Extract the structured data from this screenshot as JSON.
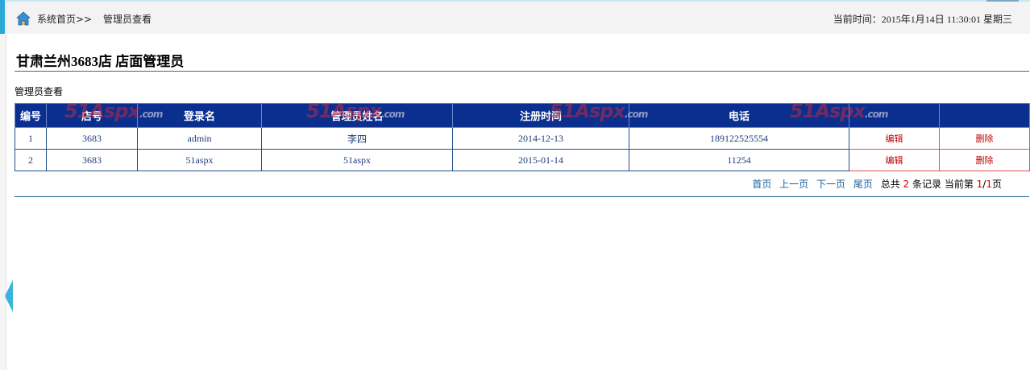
{
  "breadcrumb": {
    "home": "系统首页>>",
    "current": "管理员查看"
  },
  "clock": {
    "label": "当前时间：",
    "value": "2015年1月14日 11:30:01 星期三"
  },
  "store_title": "甘肃兰州3683店 店面管理员",
  "section_label": "管理员查看",
  "table": {
    "headers": [
      "编号",
      "店号",
      "登录名",
      "管理员姓名",
      "注册时间",
      "电话",
      "",
      ""
    ],
    "rows": [
      {
        "id": "1",
        "store": "3683",
        "login": "admin",
        "name": "李四",
        "registered": "2014-12-13",
        "phone": "189122525554",
        "edit": "编辑",
        "delete": "删除"
      },
      {
        "id": "2",
        "store": "3683",
        "login": "51aspx",
        "name": "51aspx",
        "registered": "2015-01-14",
        "phone": "11254",
        "edit": "编辑",
        "delete": "删除"
      }
    ]
  },
  "pager": {
    "first": "首页",
    "prev": "上一页",
    "next": "下一页",
    "last": "尾页",
    "total_prefix": "总共",
    "total": "2",
    "total_suffix": "条记录 当前第",
    "page": "1",
    "slash": "/",
    "pages": "1",
    "page_suffix": "页"
  },
  "watermark": {
    "brand": "51Aspx",
    "domain": ".com"
  },
  "icons": {
    "home": "home-icon"
  },
  "colors": {
    "header_bg": "#0b2f8f",
    "action_red": "#c00000",
    "accent_blue": "#29a8d8"
  }
}
